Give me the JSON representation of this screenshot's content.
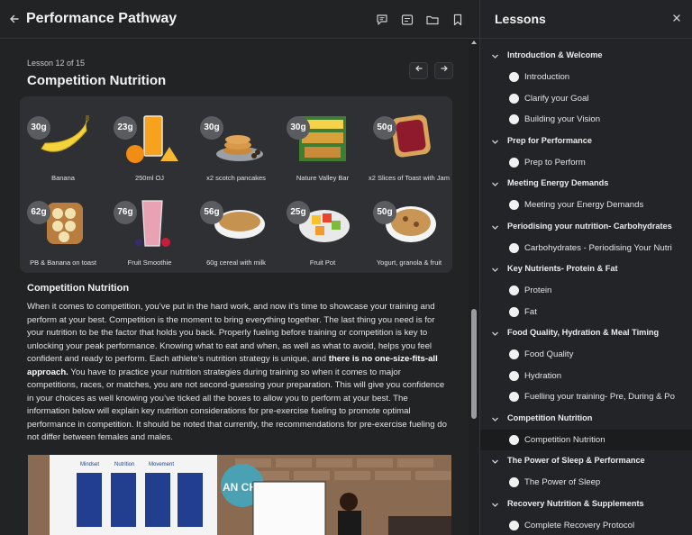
{
  "header": {
    "title": "Performance Pathway",
    "icons": [
      "back-arrow-icon",
      "comment-icon",
      "notes-icon",
      "folder-icon",
      "bookmark-icon"
    ]
  },
  "lesson": {
    "counter": "Lesson 12 of 15",
    "title": "Competition Nutrition"
  },
  "foods": [
    {
      "grams": "30g",
      "name": "Banana"
    },
    {
      "grams": "23g",
      "name": "250ml OJ"
    },
    {
      "grams": "30g",
      "name": "x2 scotch pancakes"
    },
    {
      "grams": "30g",
      "name": "Nature Valley Bar"
    },
    {
      "grams": "50g",
      "name": "x2 Slices of Toast with Jam"
    },
    {
      "grams": "62g",
      "name": "PB & Banana on toast"
    },
    {
      "grams": "76g",
      "name": "Fruit Smoothie"
    },
    {
      "grams": "56g",
      "name": "60g cereal with milk"
    },
    {
      "grams": "25g",
      "name": "Fruit Pot"
    },
    {
      "grams": "50g",
      "name": "Yogurt, granola & fruit"
    }
  ],
  "content": {
    "heading": "Competition Nutrition",
    "para_a": "When it comes to competition, you’ve put in the hard work, and now it’s time to showcase your training and perform at your best. Competition is the moment to bring everything together. The last thing you need is for your nutrition to be the factor that holds you back. Properly fueling before training or competition is key to unlocking your peak performance. Knowing what to eat and when, as well as what to avoid, helps you feel confident and ready to perform. Each athlete’s nutrition strategy is unique, and ",
    "para_bold": "there is no one-size-fits-all approach.",
    "para_b": " You have to practice your nutrition strategies during training so when it comes to major competitions, races, or matches, you are not second-guessing your preparation. This will give you confidence in your choices as well knowing you’ve ticked all the boxes to allow you to perform at your best. The information below will explain key nutrition considerations for pre-exercise fueling to promote optimal performance in competition. It should be noted that currently, the recommendations for pre-exercise fueling do not differ between females and males."
  },
  "photo": {
    "board_headings": [
      "Mindset",
      "Nutrition",
      "Movement"
    ],
    "logo_text": "AN CHO"
  },
  "sidebar": {
    "title": "Lessons",
    "sections": [
      {
        "label": "Introduction & Welcome",
        "lessons": [
          "Introduction",
          "Clarify your Goal",
          "Building your Vision"
        ]
      },
      {
        "label": "Prep for Performance",
        "lessons": [
          "Prep to Perform"
        ]
      },
      {
        "label": "Meeting Energy Demands",
        "lessons": [
          "Meeting your Energy Demands"
        ]
      },
      {
        "label": "Periodising your nutrition- Carbohydrates",
        "lessons": [
          "Carbohydrates - Periodising Your Nutri"
        ]
      },
      {
        "label": "Key Nutrients- Protein & Fat",
        "lessons": [
          "Protein",
          "Fat"
        ]
      },
      {
        "label": "Food Quality, Hydration & Meal Timing",
        "lessons": [
          "Food Quality",
          "Hydration",
          "Fuelling your training- Pre, During & Po"
        ]
      },
      {
        "label": "Competition Nutrition",
        "lessons": [
          "Competition Nutrition"
        ]
      },
      {
        "label": "The Power of Sleep & Performance",
        "lessons": [
          "The Power of Sleep"
        ]
      },
      {
        "label": "Recovery Nutrition & Supplements",
        "lessons": [
          "Complete Recovery Protocol"
        ]
      }
    ]
  },
  "colors": {
    "background": "#222325",
    "card": "#2f3033",
    "active_row": "#1b1c1e",
    "badge": "#5b5c60"
  }
}
